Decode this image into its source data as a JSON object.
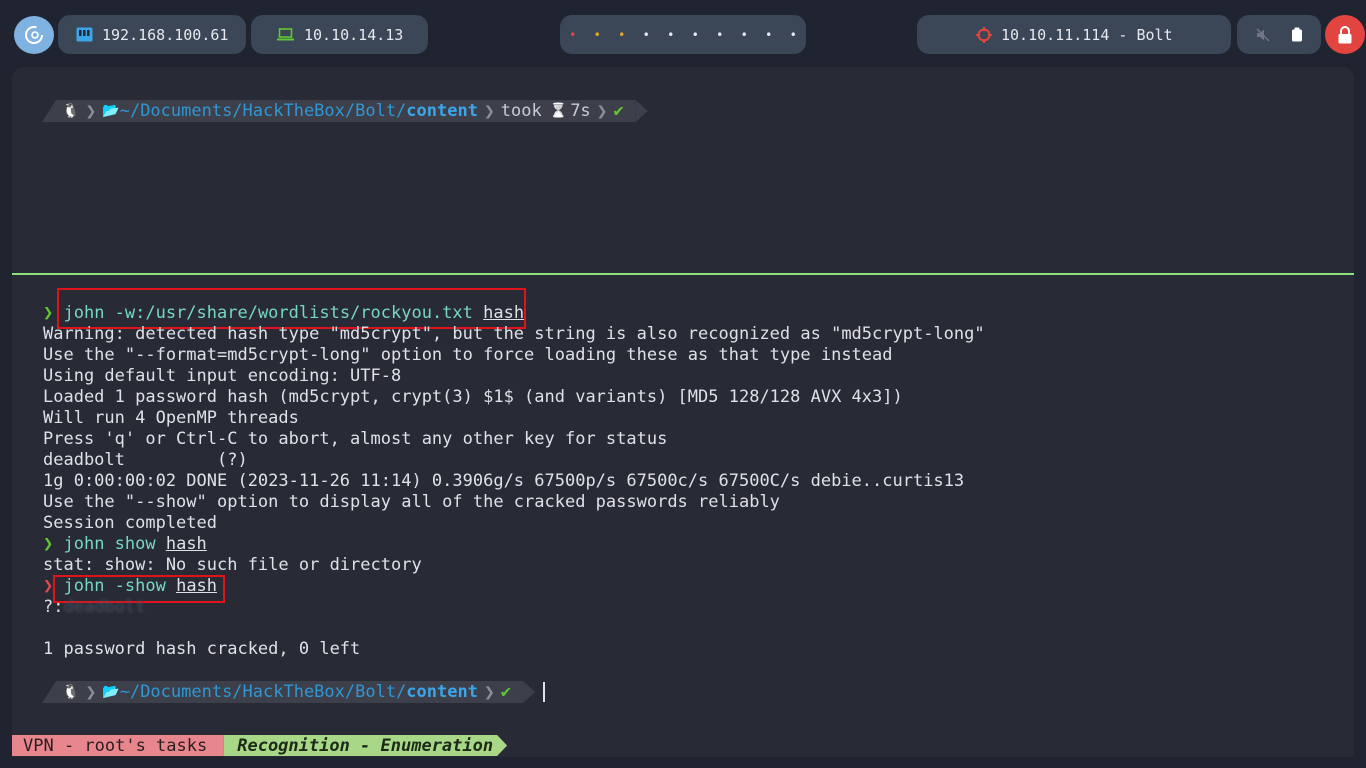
{
  "topbar": {
    "ip_local": "192.168.100.61",
    "ip_vpn": "10.10.14.13",
    "target": "10.10.11.114 - Bolt",
    "workspace_dots": [
      {
        "color": "#e2453f"
      },
      {
        "color": "#e5a823"
      },
      {
        "color": "#e5a823"
      },
      {
        "color": "#e6e9ef"
      },
      {
        "color": "#e6e9ef"
      },
      {
        "color": "#e6e9ef"
      },
      {
        "color": "#e6e9ef"
      },
      {
        "color": "#e6e9ef"
      },
      {
        "color": "#e6e9ef"
      },
      {
        "color": "#e6e9ef"
      }
    ]
  },
  "prompt1": {
    "linux_icon": "🐧",
    "folder_icon": "📂",
    "path_prefix": "~/Documents/HackTheBox/Bolt/",
    "path_last": "content",
    "took_label": "took",
    "hourglass": "⌛",
    "took_value": "7s",
    "check": "✔"
  },
  "terminal": {
    "cmd1_prefix": "john -w:/usr/share/wordlists/rockyou.txt ",
    "cmd1_arg": "hash",
    "lines": [
      "Warning: detected hash type \"md5crypt\", but the string is also recognized as \"md5crypt-long\"",
      "Use the \"--format=md5crypt-long\" option to force loading these as that type instead",
      "Using default input encoding: UTF-8",
      "Loaded 1 password hash (md5crypt, crypt(3) $1$ (and variants) [MD5 128/128 AVX 4x3])",
      "Will run 4 OpenMP threads",
      "Press 'q' or Ctrl-C to abort, almost any other key for status",
      "deadbolt         (?)",
      "1g 0:00:00:02 DONE (2023-11-26 11:14) 0.3906g/s 67500p/s 67500c/s 67500C/s debie..curtis13",
      "Use the \"--show\" option to display all of the cracked passwords reliably",
      "Session completed"
    ],
    "cmd2_prefix": "john show ",
    "cmd2_arg": "hash",
    "cmd2_out": "stat: show: No such file or directory",
    "cmd3_prefix": "john -show ",
    "cmd3_arg": "hash",
    "show_prefix": "?:",
    "show_blurred": "deadbolt",
    "summary": "1 password hash cracked, 0 left"
  },
  "prompt2": {
    "linux_icon": "🐧",
    "folder_icon": "📂",
    "path_prefix": "~/Documents/HackTheBox/Bolt/",
    "path_last": "content",
    "check": "✔"
  },
  "status": {
    "left": "VPN - root's tasks",
    "right": "Recognition - Enumeration"
  }
}
